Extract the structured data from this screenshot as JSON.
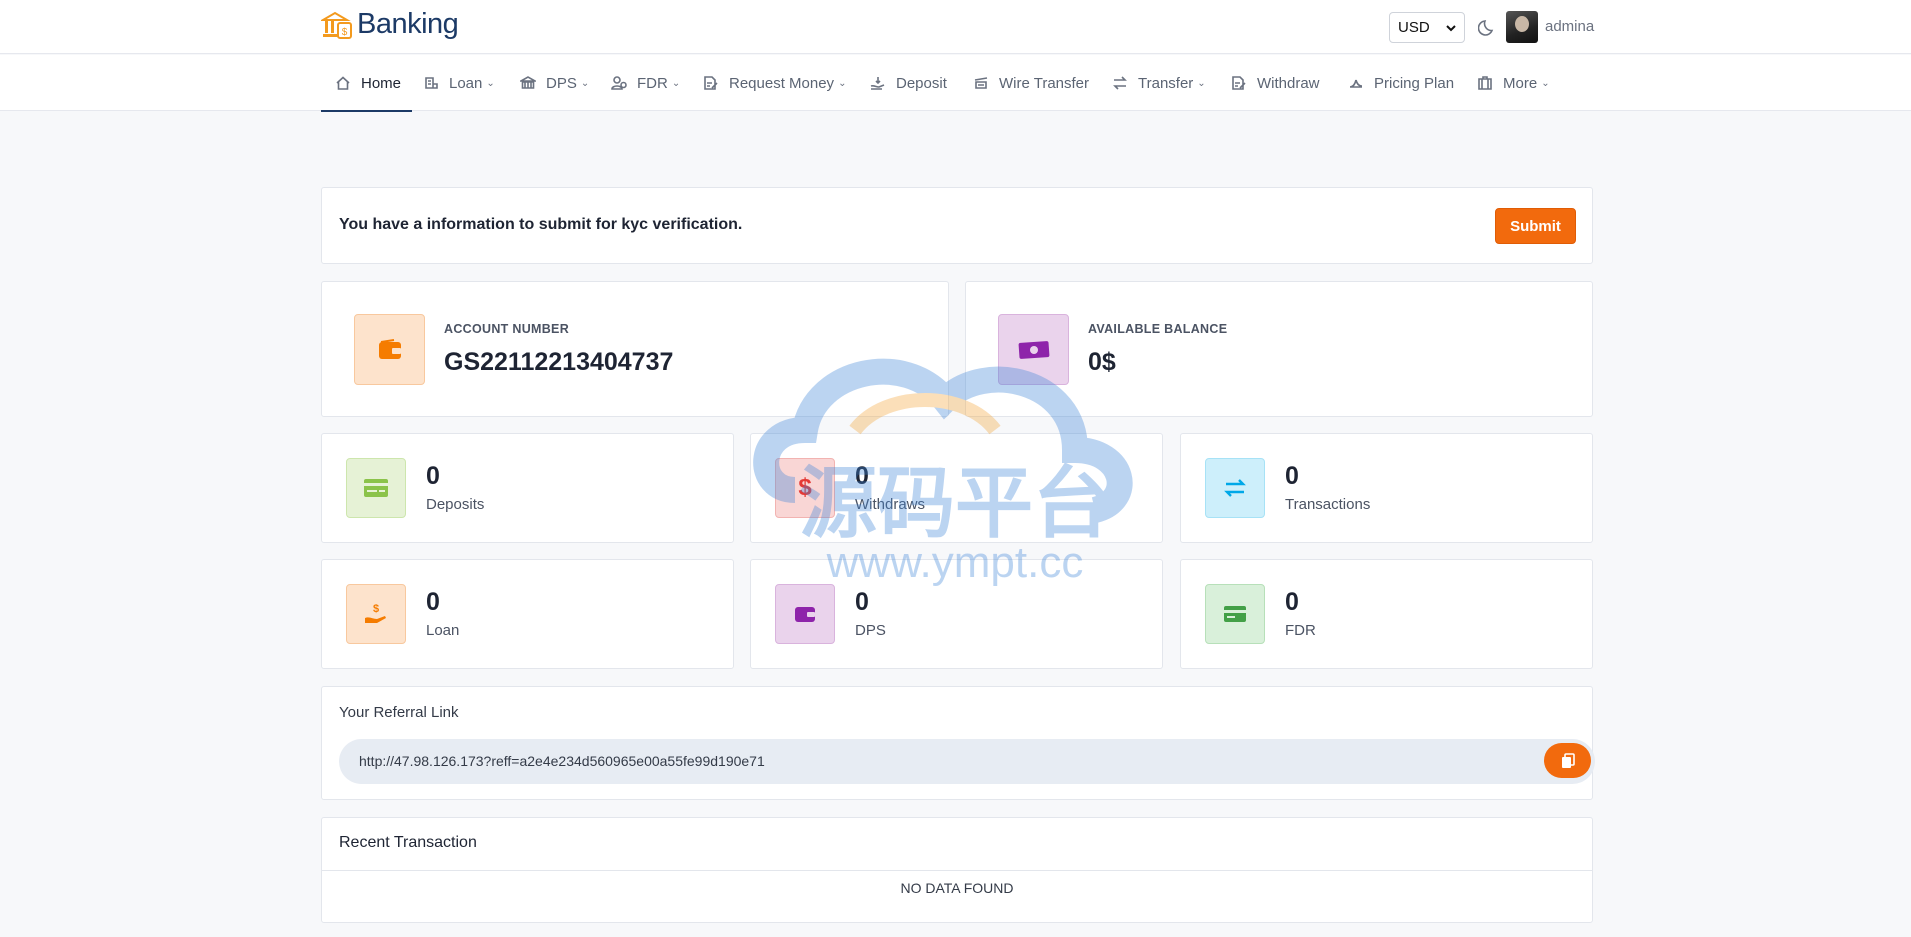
{
  "header": {
    "logo_text": "Banking",
    "currency": {
      "selected": "USD"
    },
    "user": {
      "name": "admina"
    }
  },
  "nav": {
    "items": [
      {
        "label": "Home",
        "icon": "home-icon",
        "has_caret": false,
        "active": true
      },
      {
        "label": "Loan",
        "icon": "loan-icon",
        "has_caret": true
      },
      {
        "label": "DPS",
        "icon": "dps-icon",
        "has_caret": true
      },
      {
        "label": "FDR",
        "icon": "fdr-icon",
        "has_caret": true
      },
      {
        "label": "Request Money",
        "icon": "request-money-icon",
        "has_caret": true
      },
      {
        "label": "Deposit",
        "icon": "deposit-icon",
        "has_caret": false
      },
      {
        "label": "Wire Transfer",
        "icon": "wire-transfer-icon",
        "has_caret": false
      },
      {
        "label": "Transfer",
        "icon": "transfer-icon",
        "has_caret": true
      },
      {
        "label": "Withdraw",
        "icon": "withdraw-icon",
        "has_caret": false
      },
      {
        "label": "Pricing Plan",
        "icon": "pricing-plan-icon",
        "has_caret": false
      },
      {
        "label": "More",
        "icon": "more-icon",
        "has_caret": true
      }
    ]
  },
  "kyc": {
    "message": "You have a information to submit for kyc verification.",
    "submit_label": "Submit"
  },
  "account": {
    "number_label": "ACCOUNT NUMBER",
    "number": "GS22112213404737",
    "balance_label": "AVAILABLE BALANCE",
    "balance": "0$"
  },
  "stats": [
    {
      "value": "0",
      "label": "Deposits",
      "icon": "deposit-card-icon",
      "color": "#8bc34a"
    },
    {
      "value": "0",
      "label": "Withdraws",
      "icon": "dollar-icon",
      "color": "#e53935"
    },
    {
      "value": "0",
      "label": "Transactions",
      "icon": "exchange-arrows-icon",
      "color": "#00a8e8"
    },
    {
      "value": "0",
      "label": "Loan",
      "icon": "hand-money-icon",
      "color": "#f57c00"
    },
    {
      "value": "0",
      "label": "DPS",
      "icon": "wallet-icon",
      "color": "#8e24aa"
    },
    {
      "value": "0",
      "label": "FDR",
      "icon": "credit-card-icon",
      "color": "#43a047"
    }
  ],
  "referral": {
    "title": "Your Referral Link",
    "url": "http://47.98.126.173?reff=a2e4e234d560965e00a55fe99d190e71"
  },
  "recent": {
    "title": "Recent Transaction",
    "empty_text": "NO DATA FOUND"
  },
  "watermark": {
    "text": "源码平台",
    "url": "www.ympt.cc"
  },
  "colors": {
    "accent": "#f26a0d",
    "brand": "#1c3a66"
  }
}
